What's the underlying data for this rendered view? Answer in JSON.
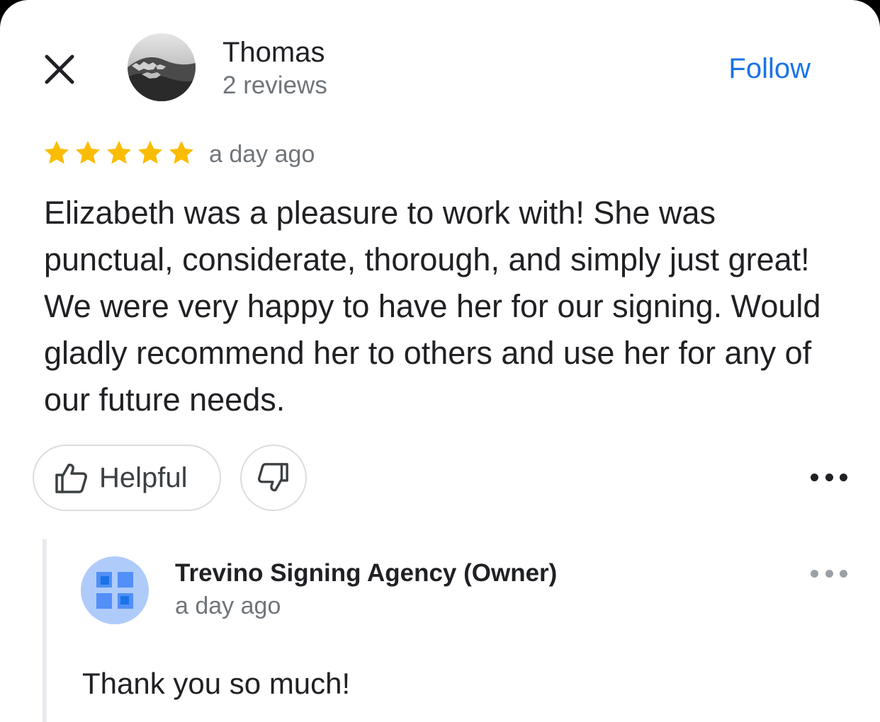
{
  "reviewer": {
    "name": "Thomas",
    "review_count": "2 reviews",
    "follow_label": "Follow"
  },
  "review": {
    "rating": 5,
    "max_rating": 5,
    "time": "a day ago",
    "text": "Elizabeth was a pleasure to work with! She was punctual, considerate, thorough, and simply just great! We were very happy to have her for our signing. Would gladly recommend her to others and use her for any of our future needs."
  },
  "actions": {
    "helpful_label": "Helpful",
    "helpful_icon": "thumbs-up-icon",
    "unhelpful_icon": "thumbs-down-icon",
    "more_icon": "more-horizontal-icon"
  },
  "owner_reply": {
    "name": "Trevino Signing Agency (Owner)",
    "time": "a day ago",
    "text": "Thank you so much!"
  },
  "colors": {
    "accent": "#1a73e8",
    "star": "#fbbc04",
    "text_primary": "#202124",
    "text_secondary": "#70757a",
    "owner_avatar_bg": "#aecbfa",
    "owner_avatar_fg": "#4285f4"
  }
}
